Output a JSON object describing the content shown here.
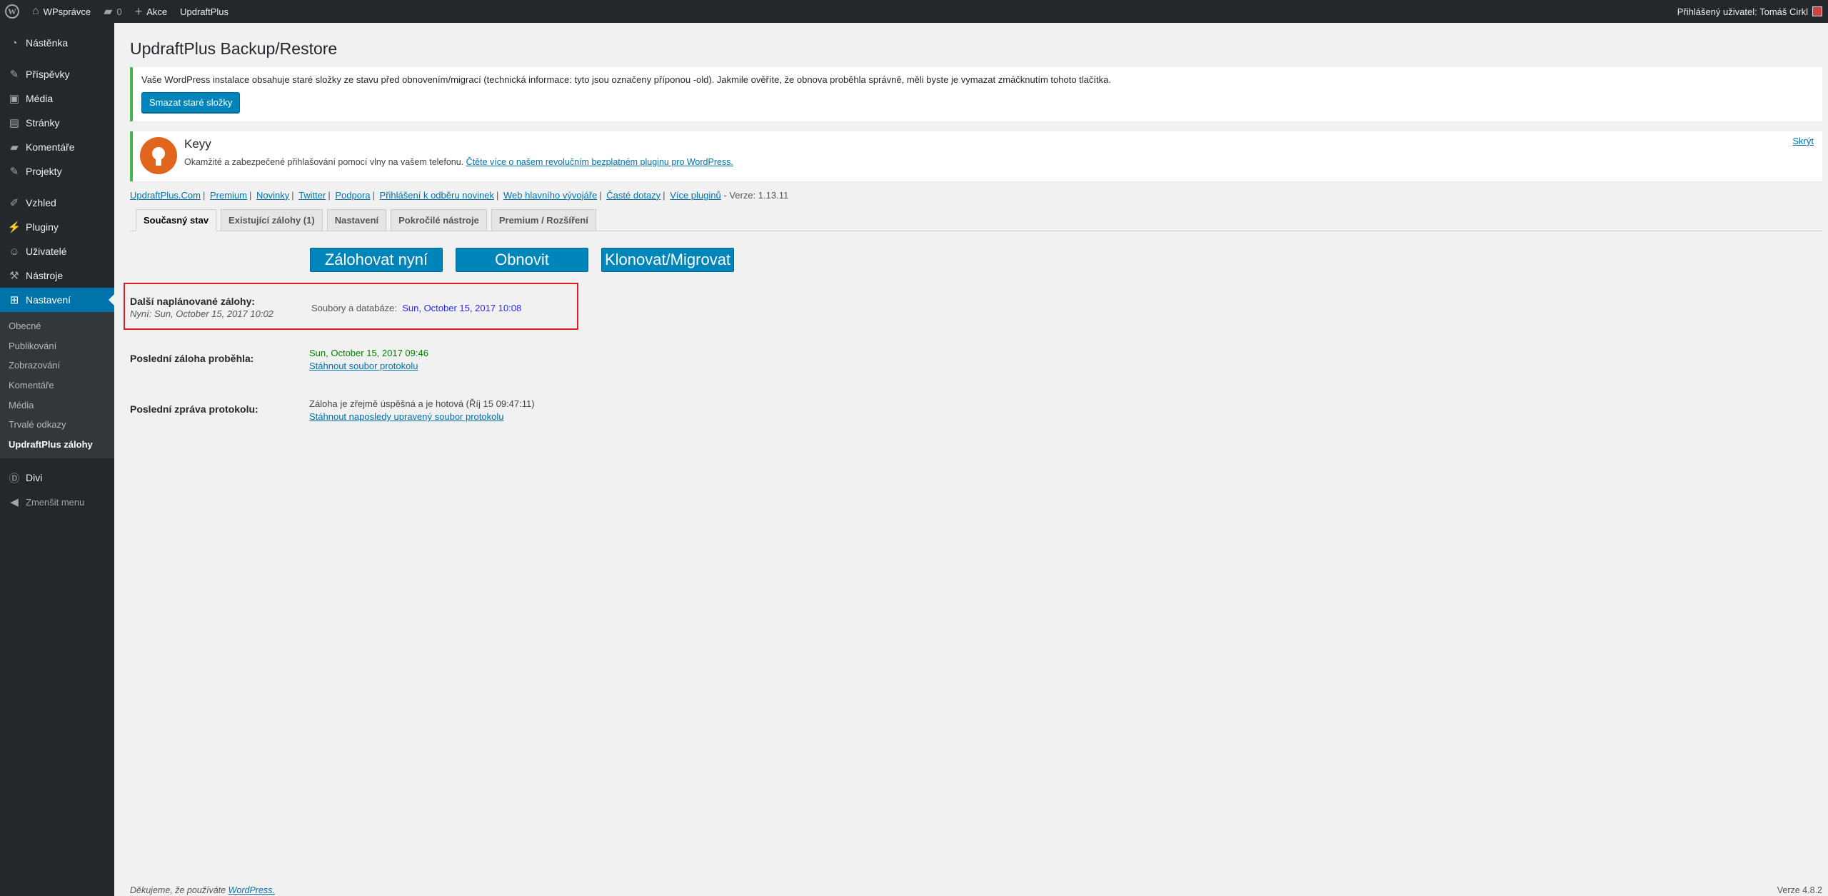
{
  "adminbar": {
    "site_name": "WPsprávce",
    "comments_count": "0",
    "new_label": "Akce",
    "plugin_label": "UpdraftPlus",
    "user_greeting": "Přihlášený uživatel: Tomáš Cirkl"
  },
  "sidebar": {
    "items": [
      {
        "label": "Nástěnka",
        "icon": "dashboard-icon"
      },
      {
        "label": "Příspěvky",
        "icon": "pin-icon"
      },
      {
        "label": "Média",
        "icon": "media-icon"
      },
      {
        "label": "Stránky",
        "icon": "pages-icon"
      },
      {
        "label": "Komentáře",
        "icon": "comments-icon"
      },
      {
        "label": "Projekty",
        "icon": "pin-icon"
      },
      {
        "label": "Vzhled",
        "icon": "brush-icon"
      },
      {
        "label": "Pluginy",
        "icon": "plugin-icon"
      },
      {
        "label": "Uživatelé",
        "icon": "users-icon"
      },
      {
        "label": "Nástroje",
        "icon": "wrench-icon"
      },
      {
        "label": "Nastavení",
        "icon": "settings-icon"
      }
    ],
    "submenu": [
      "Obecné",
      "Publikování",
      "Zobrazování",
      "Komentáře",
      "Média",
      "Trvalé odkazy",
      "UpdraftPlus zálohy"
    ],
    "divi": "Divi",
    "collapse": "Zmenšit menu"
  },
  "page": {
    "title": "UpdraftPlus Backup/Restore"
  },
  "notice_old_folders": {
    "text": "Vaše WordPress instalace obsahuje staré složky ze stavu před obnovením/migrací (technická informace: tyto jsou označeny příponou -old). Jakmile ověříte, že obnova proběhla správně, měli byste je vymazat zmáčknutím tohoto tlačítka.",
    "button": "Smazat staré složky"
  },
  "notice_keyy": {
    "title": "Keyy",
    "text": "Okamžité a zabezpečené přihlašování pomocí vlny na vašem telefonu.",
    "link": "Čtěte více o našem revolučním bezplatném pluginu pro WordPress.",
    "dismiss": "Skrýt"
  },
  "links": [
    "UpdraftPlus.Com",
    "Premium",
    "Novinky",
    "Twitter",
    "Podpora",
    "Přihlášení k odběru novinek",
    "Web hlavního vývojáře",
    "Časté dotazy",
    "Více pluginů"
  ],
  "version_text": "- Verze: 1.13.11",
  "tabs": [
    "Současný stav",
    "Existující zálohy (1)",
    "Nastavení",
    "Pokročilé nástroje",
    "Premium / Rozšíření"
  ],
  "actions": {
    "backup": "Zálohovat nyní",
    "restore": "Obnovit",
    "clone": "Klonovat/Migrovat"
  },
  "scheduled": {
    "label": "Další naplánované zálohy:",
    "now": "Nyní: Sun, October 15, 2017 10:02",
    "files_db_label": "Soubory a databáze:",
    "files_db_value": "Sun, October 15, 2017 10:08"
  },
  "last_backup": {
    "label": "Poslední záloha proběhla:",
    "date": "Sun, October 15, 2017 09:46",
    "link": "Stáhnout soubor protokolu"
  },
  "last_log": {
    "label": "Poslední zpráva protokolu:",
    "text": "Záloha je zřejmě úspěšná a je hotová (Říj 15 09:47:11)",
    "link": "Stáhnout naposledy upravený soubor protokolu"
  },
  "footer": {
    "thanks": "Děkujeme, že používáte",
    "wp_link": "WordPress.",
    "version": "Verze 4.8.2"
  },
  "colors": {
    "accent": "#0073aa",
    "button": "#0085ba",
    "admin_bg": "#23282d",
    "notice_green": "#46b450",
    "highlight_red": "#e02020",
    "keyy_orange": "#e2651e"
  }
}
